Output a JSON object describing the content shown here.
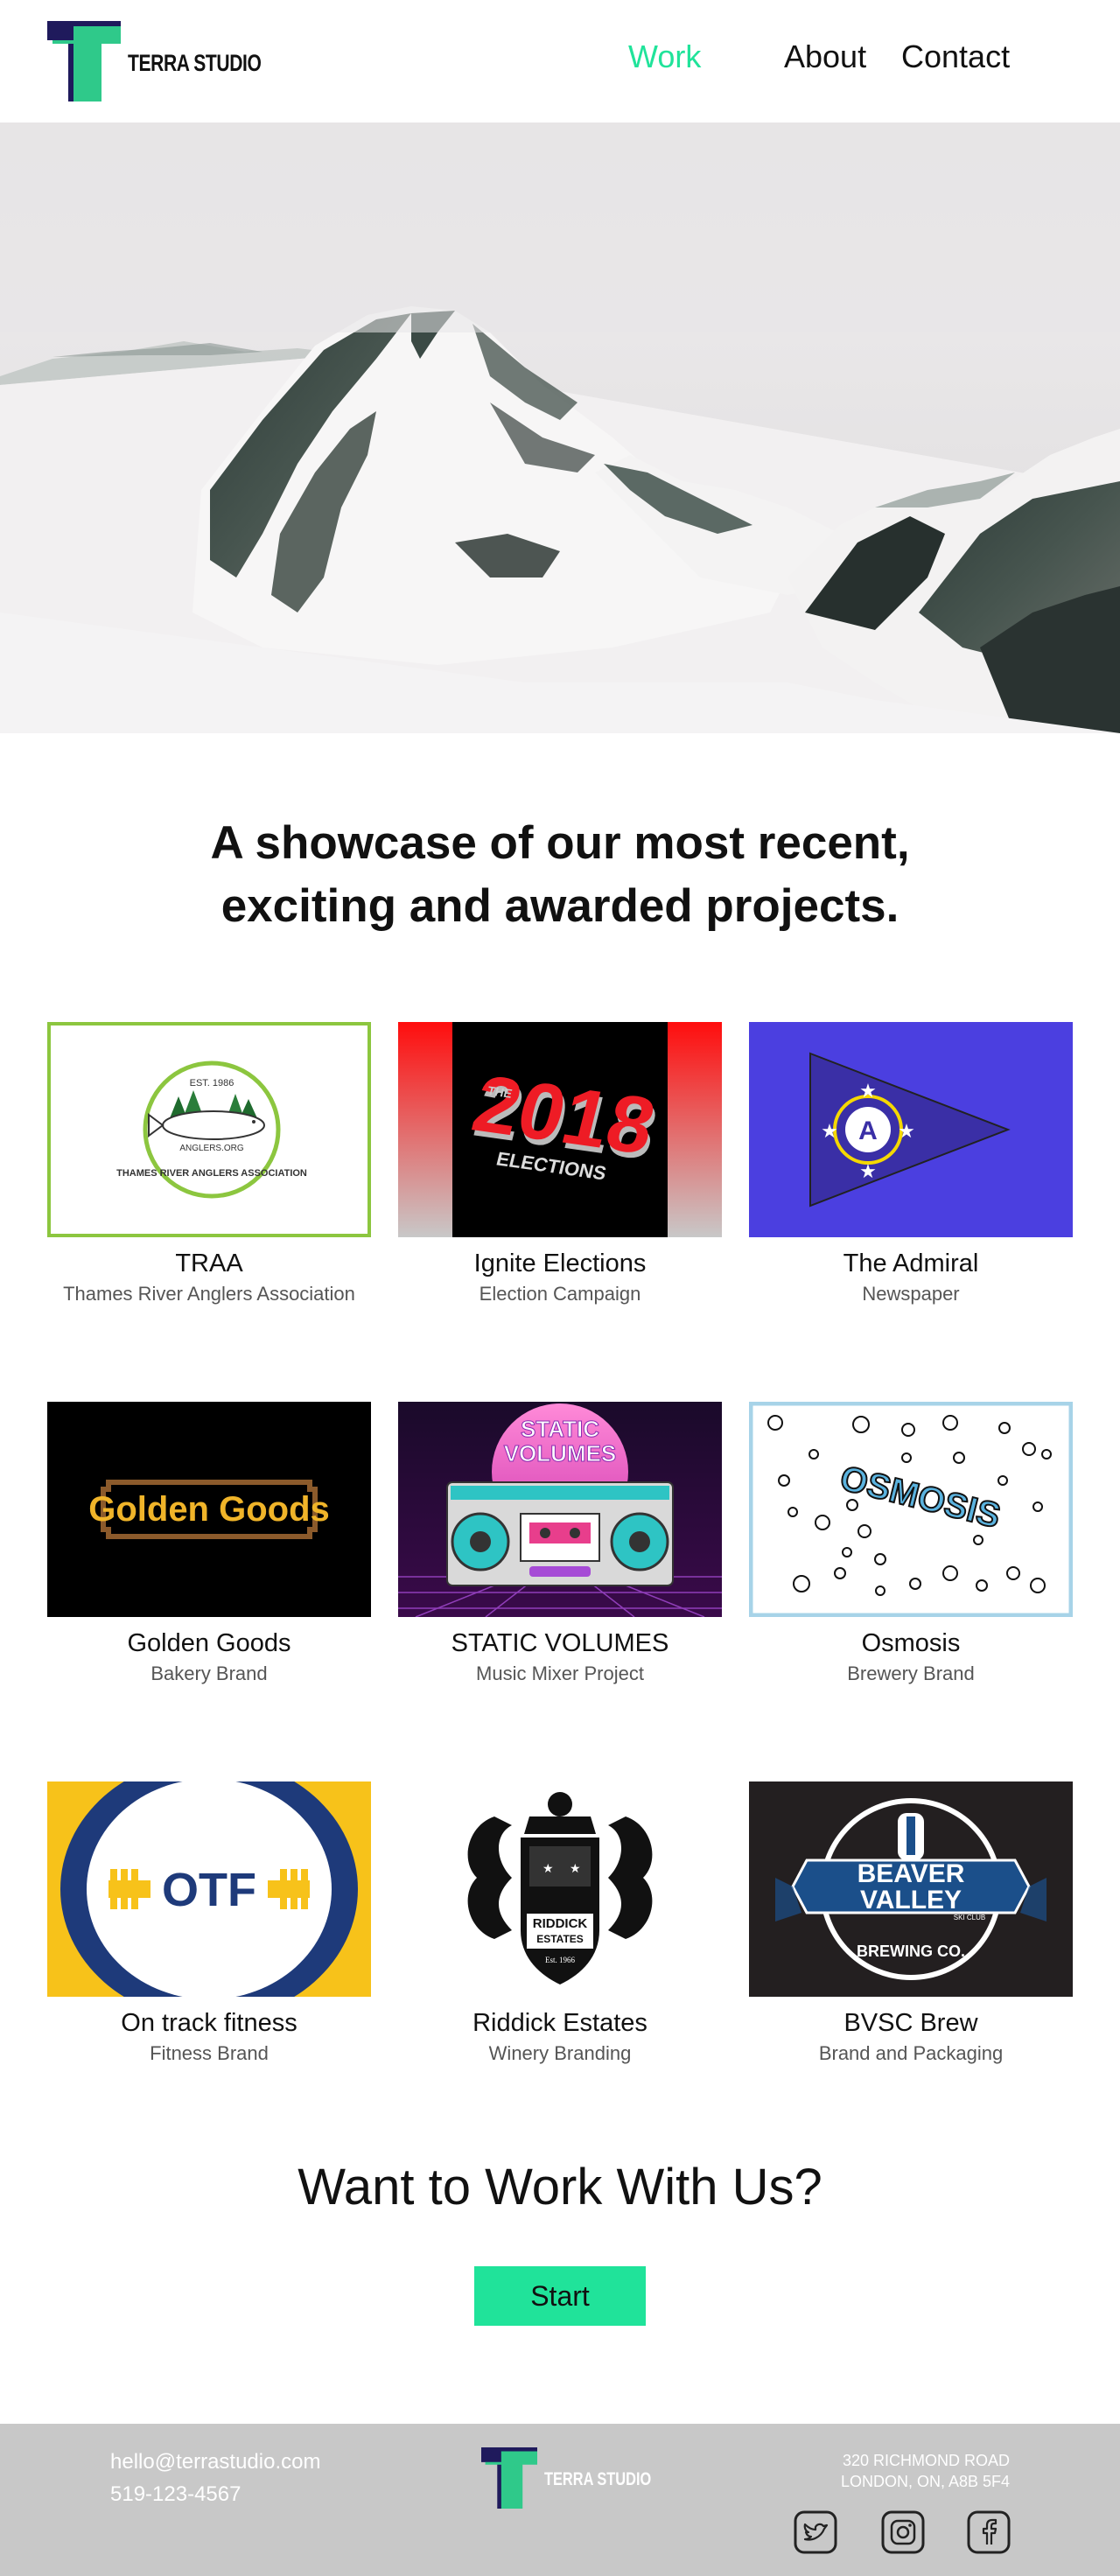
{
  "brand": {
    "name": "TERRA STUDIO"
  },
  "nav": {
    "items": [
      "Work",
      "About",
      "Contact"
    ],
    "active": "Work"
  },
  "intro": {
    "line1": "A showcase of our most recent,",
    "line2": "exciting and awarded projects."
  },
  "projects": [
    {
      "title": "TRAA",
      "subtitle": "Thames River Anglers Association",
      "badge_year": "EST. 1986",
      "badge_url": "ANGLERS.ORG",
      "badge_ring": "THAMES RIVER ANGLERS ASSOCIATION"
    },
    {
      "title": "Ignite Elections",
      "subtitle": "Election Campaign",
      "art_text": "2018",
      "art_small": "THE",
      "art_small2": "ELECTIONS"
    },
    {
      "title": "The Admiral",
      "subtitle": "Newspaper",
      "art_letter": "A"
    },
    {
      "title": "Golden Goods",
      "subtitle": "Bakery Brand",
      "art_text": "Golden Goods"
    },
    {
      "title": "STATIC VOLUMES",
      "subtitle": "Music Mixer Project",
      "art_line1": "STATIC",
      "art_line2": "VOLUMES"
    },
    {
      "title": "Osmosis",
      "subtitle": "Brewery Brand",
      "art_text": "OSMOSIS"
    },
    {
      "title": "On track fitness",
      "subtitle": "Fitness Brand",
      "art_text": "OTF"
    },
    {
      "title": "Riddick Estates",
      "subtitle": "Winery Branding",
      "art_line1": "RIDDICK",
      "art_line2": "ESTATES",
      "art_line3": "Est. 1966"
    },
    {
      "title": "BVSC Brew",
      "subtitle": "Brand and Packaging",
      "art_line1": "BEAVER",
      "art_line2": "VALLEY",
      "art_small": "SKI CLUB",
      "art_arc": "BREWING CO."
    }
  ],
  "cta": {
    "title": "Want to Work With Us?",
    "button": "Start"
  },
  "footer": {
    "email": "hello@terrastudio.com",
    "phone": "519-123-4567",
    "address_line1": "320 RICHMOND ROAD",
    "address_line2": "LONDON, ON, A8B 5F4",
    "social": [
      "twitter-icon",
      "instagram-icon",
      "facebook-icon"
    ]
  },
  "colors": {
    "accent": "#20e39a",
    "logo_dark": "#1f1a5c",
    "footer_bg": "#c8c8c8"
  }
}
